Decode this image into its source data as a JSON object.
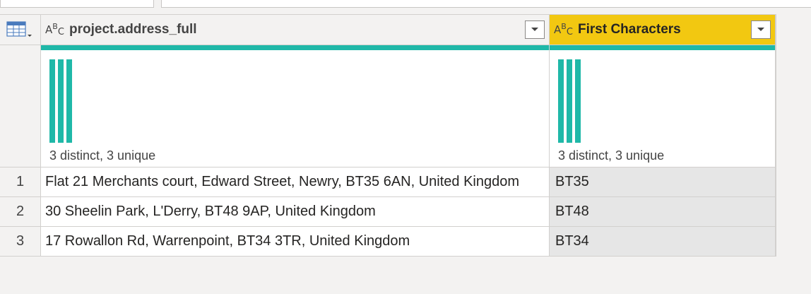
{
  "columns": [
    {
      "type_icon": "text-type-icon",
      "title": "project.address_full",
      "profile": {
        "stats": "3 distinct, 3 unique",
        "quality_valid_pct": 100
      }
    },
    {
      "type_icon": "text-type-icon",
      "title": "First Characters",
      "selected": true,
      "profile": {
        "stats": "3 distinct, 3 unique",
        "quality_valid_pct": 100
      }
    }
  ],
  "rows": [
    {
      "index": "1",
      "address": "Flat 21 Merchants court, Edward Street, Newry, BT35 6AN, United Kingdom",
      "first": "BT35"
    },
    {
      "index": "2",
      "address": "30 Sheelin Park, L'Derry, BT48 9AP, United Kingdom",
      "first": "BT48"
    },
    {
      "index": "3",
      "address": "17 Rowallon Rd, Warrenpoint, BT34 3TR, United Kingdom",
      "first": "BT34"
    }
  ],
  "colors": {
    "selected_header": "#f2c811",
    "quality_bar": "#1fb8a8",
    "distribution_bar": "#1fb8a8"
  }
}
